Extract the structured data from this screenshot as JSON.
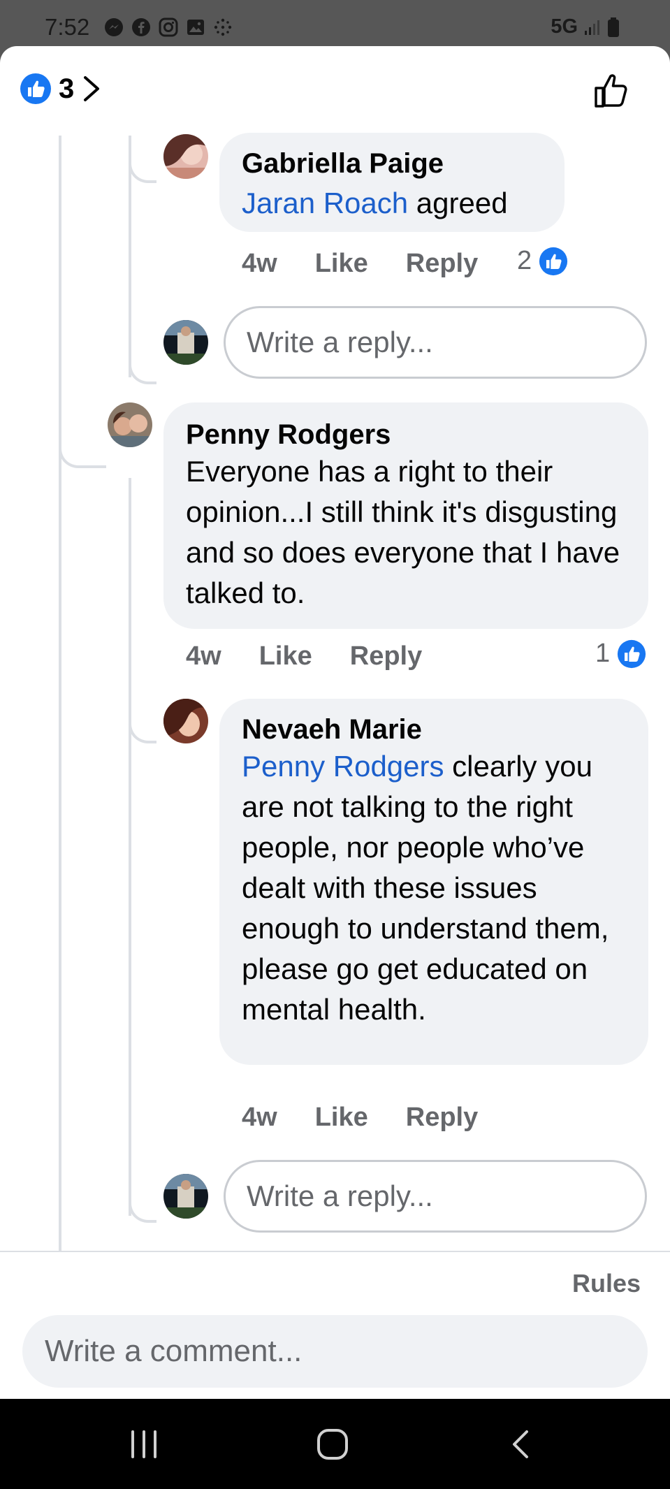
{
  "status_bar": {
    "time": "7:52",
    "network": "5G",
    "icons": [
      "messenger-icon",
      "facebook-icon",
      "instagram-icon",
      "gallery-icon",
      "dots-icon",
      "signal-icon",
      "battery-icon"
    ]
  },
  "header": {
    "reaction_count": "3",
    "icons": [
      "like-reaction-icon",
      "chevron-right-icon",
      "thumbs-up-outline-icon"
    ]
  },
  "comments": [
    {
      "author": "Gabriella Paige",
      "mention": "Jaran Roach",
      "text": " agreed",
      "time": "4w",
      "like_label": "Like",
      "reply_label": "Reply",
      "reactions": "2"
    },
    {
      "author": "Penny Rodgers",
      "mention": "",
      "text": "Everyone has a right to their opinion...I still think it's disgusting and so does everyone that I have talked to.",
      "time": "4w",
      "like_label": "Like",
      "reply_label": "Reply",
      "reactions": "1"
    },
    {
      "author": "Nevaeh Marie",
      "mention": "Penny Rodgers",
      "text": " clearly you are not talking to the right people, nor people who’ve dealt with these issues enough to understand them, please go get educated on mental health.",
      "time": "4w",
      "like_label": "Like",
      "reply_label": "Reply",
      "reactions": ""
    }
  ],
  "reply_input_placeholder": "Write a reply...",
  "rules_label": "Rules",
  "comment_input_placeholder": "Write a comment...",
  "colors": {
    "mention": "#1c5fcb",
    "like_blue": "#1877f2",
    "bubble": "#f0f2f5",
    "secondary_text": "#65676b"
  },
  "nav_icons": [
    "recent-apps-icon",
    "home-icon",
    "back-icon"
  ]
}
